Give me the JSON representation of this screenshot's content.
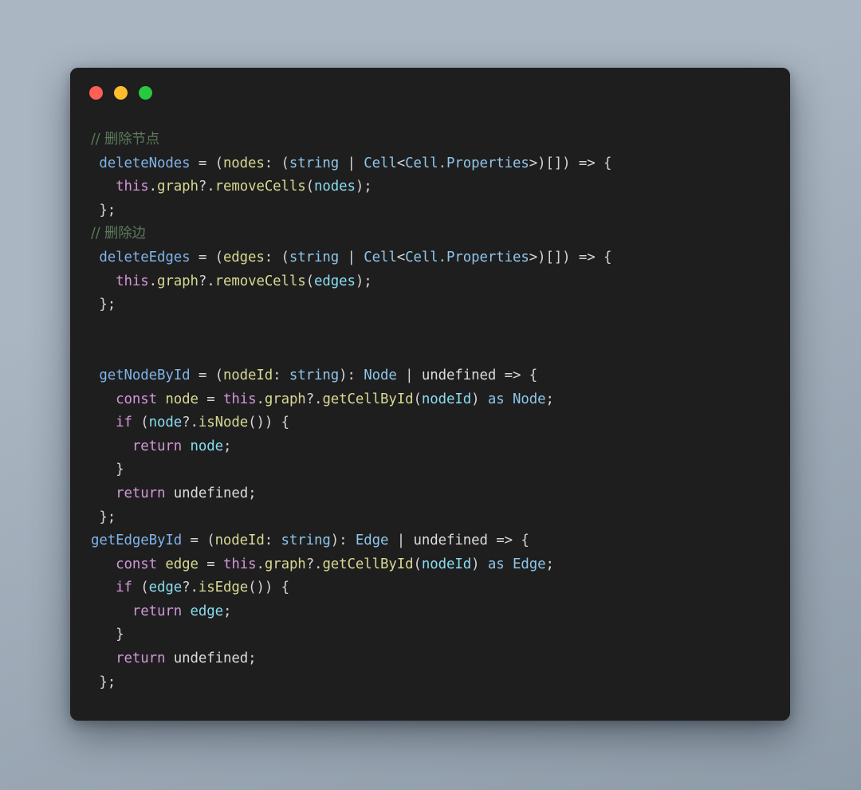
{
  "window": {
    "background_color": "#1e1e1e",
    "traffic_lights": [
      {
        "name": "close",
        "color": "#ff5f56"
      },
      {
        "name": "minimize",
        "color": "#ffbd2e"
      },
      {
        "name": "maximize",
        "color": "#27c93f"
      }
    ]
  },
  "desktop": {
    "gradient_from": "#aab6c2",
    "gradient_to": "#8e9ba8"
  },
  "editor": {
    "language": "TypeScript",
    "theme_colors": {
      "comment": "#5c7a5c",
      "keyword": "#d396d9",
      "function": "#7fb3e8",
      "parameter": "#d8d894",
      "type": "#8fc5ea",
      "variable": "#89ddf0",
      "plain": "#dcdcdc"
    },
    "lines": [
      {
        "n": 1,
        "indent": 0,
        "tokens": [
          {
            "t": "// 删除节点",
            "c": "comment"
          }
        ]
      },
      {
        "n": 2,
        "indent": 0,
        "tokens": [
          {
            "t": " ",
            "c": "plain"
          },
          {
            "t": "deleteNodes",
            "c": "fn"
          },
          {
            "t": " = (",
            "c": "punc"
          },
          {
            "t": "nodes",
            "c": "param"
          },
          {
            "t": ": (",
            "c": "punc"
          },
          {
            "t": "string",
            "c": "type"
          },
          {
            "t": " | ",
            "c": "punc"
          },
          {
            "t": "Cell",
            "c": "type"
          },
          {
            "t": "<",
            "c": "punc"
          },
          {
            "t": "Cell.Properties",
            "c": "type"
          },
          {
            "t": ">)[]) => {",
            "c": "punc"
          }
        ]
      },
      {
        "n": 3,
        "indent": 0,
        "tokens": [
          {
            "t": "   ",
            "c": "plain"
          },
          {
            "t": "this",
            "c": "kw"
          },
          {
            "t": ".",
            "c": "punc"
          },
          {
            "t": "graph",
            "c": "prop"
          },
          {
            "t": "?.",
            "c": "punc"
          },
          {
            "t": "removeCells",
            "c": "prop"
          },
          {
            "t": "(",
            "c": "punc"
          },
          {
            "t": "nodes",
            "c": "var"
          },
          {
            "t": ");",
            "c": "punc"
          }
        ]
      },
      {
        "n": 4,
        "indent": 0,
        "tokens": [
          {
            "t": " };",
            "c": "punc"
          }
        ]
      },
      {
        "n": 5,
        "indent": 0,
        "tokens": [
          {
            "t": "// 删除边",
            "c": "comment"
          }
        ]
      },
      {
        "n": 6,
        "indent": 0,
        "tokens": [
          {
            "t": " ",
            "c": "plain"
          },
          {
            "t": "deleteEdges",
            "c": "fn"
          },
          {
            "t": " = (",
            "c": "punc"
          },
          {
            "t": "edges",
            "c": "param"
          },
          {
            "t": ": (",
            "c": "punc"
          },
          {
            "t": "string",
            "c": "type"
          },
          {
            "t": " | ",
            "c": "punc"
          },
          {
            "t": "Cell",
            "c": "type"
          },
          {
            "t": "<",
            "c": "punc"
          },
          {
            "t": "Cell.Properties",
            "c": "type"
          },
          {
            "t": ">)[]) => {",
            "c": "punc"
          }
        ]
      },
      {
        "n": 7,
        "indent": 0,
        "tokens": [
          {
            "t": "   ",
            "c": "plain"
          },
          {
            "t": "this",
            "c": "kw"
          },
          {
            "t": ".",
            "c": "punc"
          },
          {
            "t": "graph",
            "c": "prop"
          },
          {
            "t": "?.",
            "c": "punc"
          },
          {
            "t": "removeCells",
            "c": "prop"
          },
          {
            "t": "(",
            "c": "punc"
          },
          {
            "t": "edges",
            "c": "var"
          },
          {
            "t": ");",
            "c": "punc"
          }
        ]
      },
      {
        "n": 8,
        "indent": 0,
        "tokens": [
          {
            "t": " };",
            "c": "punc"
          }
        ]
      },
      {
        "n": 9,
        "indent": 0,
        "tokens": []
      },
      {
        "n": 10,
        "indent": 0,
        "tokens": []
      },
      {
        "n": 11,
        "indent": 0,
        "tokens": [
          {
            "t": " ",
            "c": "plain"
          },
          {
            "t": "getNodeById",
            "c": "fn"
          },
          {
            "t": " = (",
            "c": "punc"
          },
          {
            "t": "nodeId",
            "c": "param"
          },
          {
            "t": ": ",
            "c": "punc"
          },
          {
            "t": "string",
            "c": "type"
          },
          {
            "t": "): ",
            "c": "punc"
          },
          {
            "t": "Node",
            "c": "type"
          },
          {
            "t": " | ",
            "c": "punc"
          },
          {
            "t": "undefined",
            "c": "plain"
          },
          {
            "t": " => {",
            "c": "punc"
          }
        ]
      },
      {
        "n": 12,
        "indent": 0,
        "tokens": [
          {
            "t": "   ",
            "c": "plain"
          },
          {
            "t": "const",
            "c": "kw"
          },
          {
            "t": " ",
            "c": "punc"
          },
          {
            "t": "node",
            "c": "param"
          },
          {
            "t": " = ",
            "c": "punc"
          },
          {
            "t": "this",
            "c": "kw"
          },
          {
            "t": ".",
            "c": "punc"
          },
          {
            "t": "graph",
            "c": "prop"
          },
          {
            "t": "?.",
            "c": "punc"
          },
          {
            "t": "getCellById",
            "c": "prop"
          },
          {
            "t": "(",
            "c": "punc"
          },
          {
            "t": "nodeId",
            "c": "var"
          },
          {
            "t": ") ",
            "c": "punc"
          },
          {
            "t": "as",
            "c": "type"
          },
          {
            "t": " ",
            "c": "punc"
          },
          {
            "t": "Node",
            "c": "type"
          },
          {
            "t": ";",
            "c": "punc"
          }
        ]
      },
      {
        "n": 13,
        "indent": 0,
        "tokens": [
          {
            "t": "   ",
            "c": "plain"
          },
          {
            "t": "if",
            "c": "kw"
          },
          {
            "t": " (",
            "c": "punc"
          },
          {
            "t": "node",
            "c": "var"
          },
          {
            "t": "?.",
            "c": "punc"
          },
          {
            "t": "isNode",
            "c": "prop"
          },
          {
            "t": "()) {",
            "c": "punc"
          }
        ]
      },
      {
        "n": 14,
        "indent": 0,
        "tokens": [
          {
            "t": "     ",
            "c": "plain"
          },
          {
            "t": "return",
            "c": "kw"
          },
          {
            "t": " ",
            "c": "punc"
          },
          {
            "t": "node",
            "c": "var"
          },
          {
            "t": ";",
            "c": "punc"
          }
        ]
      },
      {
        "n": 15,
        "indent": 0,
        "tokens": [
          {
            "t": "   }",
            "c": "punc"
          }
        ]
      },
      {
        "n": 16,
        "indent": 0,
        "tokens": [
          {
            "t": "   ",
            "c": "plain"
          },
          {
            "t": "return",
            "c": "kw"
          },
          {
            "t": " ",
            "c": "punc"
          },
          {
            "t": "undefined",
            "c": "plain"
          },
          {
            "t": ";",
            "c": "punc"
          }
        ]
      },
      {
        "n": 17,
        "indent": 0,
        "tokens": [
          {
            "t": " };",
            "c": "punc"
          }
        ]
      },
      {
        "n": 18,
        "indent": 0,
        "tokens": [
          {
            "t": "getEdgeById",
            "c": "fn"
          },
          {
            "t": " = (",
            "c": "punc"
          },
          {
            "t": "nodeId",
            "c": "param"
          },
          {
            "t": ": ",
            "c": "punc"
          },
          {
            "t": "string",
            "c": "type"
          },
          {
            "t": "): ",
            "c": "punc"
          },
          {
            "t": "Edge",
            "c": "type"
          },
          {
            "t": " | ",
            "c": "punc"
          },
          {
            "t": "undefined",
            "c": "plain"
          },
          {
            "t": " => {",
            "c": "punc"
          }
        ]
      },
      {
        "n": 19,
        "indent": 0,
        "tokens": [
          {
            "t": "   ",
            "c": "plain"
          },
          {
            "t": "const",
            "c": "kw"
          },
          {
            "t": " ",
            "c": "punc"
          },
          {
            "t": "edge",
            "c": "param"
          },
          {
            "t": " = ",
            "c": "punc"
          },
          {
            "t": "this",
            "c": "kw"
          },
          {
            "t": ".",
            "c": "punc"
          },
          {
            "t": "graph",
            "c": "prop"
          },
          {
            "t": "?.",
            "c": "punc"
          },
          {
            "t": "getCellById",
            "c": "prop"
          },
          {
            "t": "(",
            "c": "punc"
          },
          {
            "t": "nodeId",
            "c": "var"
          },
          {
            "t": ") ",
            "c": "punc"
          },
          {
            "t": "as",
            "c": "type"
          },
          {
            "t": " ",
            "c": "punc"
          },
          {
            "t": "Edge",
            "c": "type"
          },
          {
            "t": ";",
            "c": "punc"
          }
        ]
      },
      {
        "n": 20,
        "indent": 0,
        "tokens": [
          {
            "t": "   ",
            "c": "plain"
          },
          {
            "t": "if",
            "c": "kw"
          },
          {
            "t": " (",
            "c": "punc"
          },
          {
            "t": "edge",
            "c": "var"
          },
          {
            "t": "?.",
            "c": "punc"
          },
          {
            "t": "isEdge",
            "c": "prop"
          },
          {
            "t": "()) {",
            "c": "punc"
          }
        ]
      },
      {
        "n": 21,
        "indent": 0,
        "tokens": [
          {
            "t": "     ",
            "c": "plain"
          },
          {
            "t": "return",
            "c": "kw"
          },
          {
            "t": " ",
            "c": "punc"
          },
          {
            "t": "edge",
            "c": "var"
          },
          {
            "t": ";",
            "c": "punc"
          }
        ]
      },
      {
        "n": 22,
        "indent": 0,
        "tokens": [
          {
            "t": "   }",
            "c": "punc"
          }
        ]
      },
      {
        "n": 23,
        "indent": 0,
        "tokens": [
          {
            "t": "   ",
            "c": "plain"
          },
          {
            "t": "return",
            "c": "kw"
          },
          {
            "t": " ",
            "c": "punc"
          },
          {
            "t": "undefined",
            "c": "plain"
          },
          {
            "t": ";",
            "c": "punc"
          }
        ]
      },
      {
        "n": 24,
        "indent": 0,
        "tokens": [
          {
            "t": " };",
            "c": "punc"
          }
        ]
      }
    ]
  }
}
